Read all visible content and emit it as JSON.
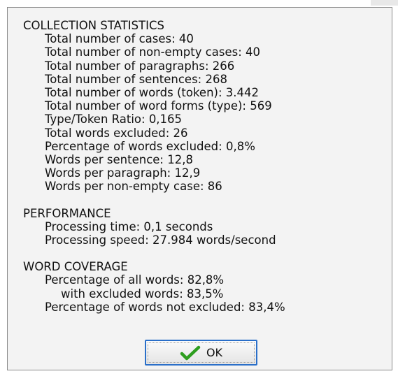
{
  "sections": {
    "collection": {
      "title": "COLLECTION STATISTICS",
      "items": [
        "Total number of cases: 40",
        "Total number of non-empty cases: 40",
        "Total number of paragraphs: 266",
        "Total number of sentences: 268",
        "Total number of words (token): 3.442",
        "Total number of word forms (type): 569",
        "Type/Token Ratio: 0,165",
        "Total words excluded: 26",
        "Percentage of words excluded: 0,8%",
        "Words per sentence: 12,8",
        "Words per paragraph: 12,9",
        "Words per non-empty case: 86"
      ]
    },
    "performance": {
      "title": "PERFORMANCE",
      "items": [
        "Processing time: 0,1 seconds",
        "Processing speed: 27.984 words/second"
      ]
    },
    "coverage": {
      "title": "WORD COVERAGE",
      "items": [
        "Percentage of all words: 82,8%",
        "with excluded words: 83,5%",
        "Percentage of words not excluded: 83,4%"
      ]
    }
  },
  "ok_button": {
    "label": "OK",
    "icon": "checkmark-icon",
    "icon_color": "#2e9e1f"
  }
}
